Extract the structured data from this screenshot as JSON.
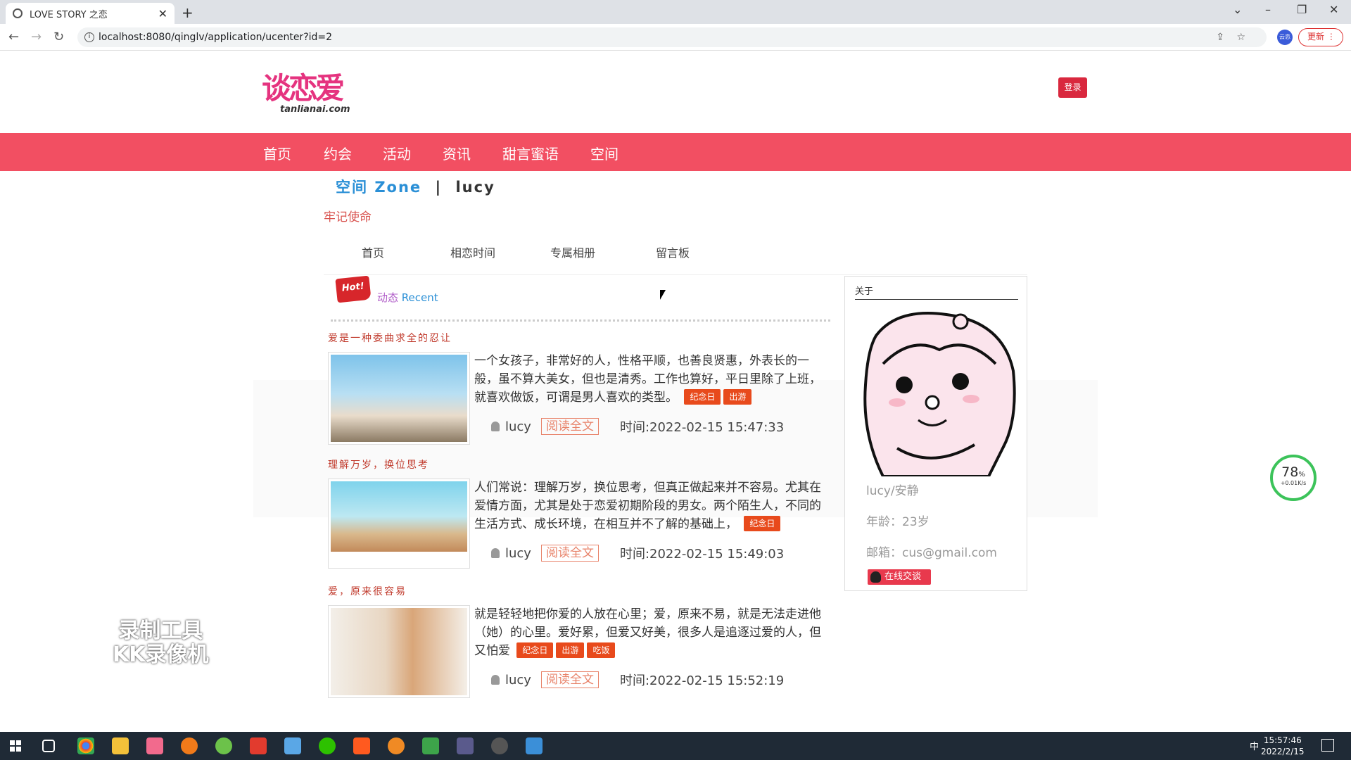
{
  "browser": {
    "tab_title": "LOVE STORY 之恋",
    "url": "localhost:8080/qinglv/application/ucenter?id=2",
    "update_label": "更新",
    "profile_chip": "云恋"
  },
  "site": {
    "logo_text": "谈恋爱",
    "logo_sub": "tanlianai.com",
    "login_label": "登录",
    "nav": [
      "首页",
      "约会",
      "活动",
      "资讯",
      "甜言蜜语",
      "空间"
    ]
  },
  "zone": {
    "title_cn": "空间",
    "title_en": "Zone",
    "separator": "|",
    "username": "lucy",
    "motto": "牢记使命",
    "subnav": [
      "首页",
      "相恋时间",
      "专属相册",
      "留言板"
    ]
  },
  "recent": {
    "hot_badge": "Hot!",
    "label_cn": "动态",
    "label_en": "Recent"
  },
  "posts": [
    {
      "title": "爱是一种委曲求全的忍让",
      "text": "一个女孩子，非常好的人，性格平顺，也善良贤惠，外表长的一般，虽不算大美女，但也是清秀。工作也算好，平日里除了上班，就喜欢做饭，可谓是男人喜欢的类型。",
      "tags": [
        "纪念日",
        "出游"
      ],
      "author": "lucy",
      "read_label": "阅读全文",
      "time": "时间:2022-02-15 15:47:33"
    },
    {
      "title": "理解万岁，换位思考",
      "text": "人们常说：理解万岁，换位思考，但真正做起来并不容易。尤其在爱情方面，尤其是处于恋爱初期阶段的男女。两个陌生人，不同的生活方式、成长环境，在相互并不了解的基础上，",
      "tags": [
        "纪念日"
      ],
      "author": "lucy",
      "read_label": "阅读全文",
      "time": "时间:2022-02-15 15:49:03"
    },
    {
      "title": "爱，原来很容易",
      "text": "就是轻轻地把你爱的人放在心里；爱，原来不易，就是无法走进他（她）的心里。爱好累，但爱又好美，很多人是追逐过爱的人，但又怕爱",
      "tags": [
        "纪念日",
        "出游",
        "吃饭"
      ],
      "author": "lucy",
      "read_label": "阅读全文",
      "time": "时间:2022-02-15 15:52:19"
    }
  ],
  "sidebar": {
    "heading": "关于",
    "name": "lucy/安静",
    "age": "年龄：23岁",
    "email": "邮箱：cus@gmail.com",
    "chat_label": "在线交谈"
  },
  "overlay": {
    "watermark_line1": "录制工具",
    "watermark_line2": "KK录像机",
    "speed_pct": "78",
    "speed_unit": "%",
    "speed_rate": "+0.01K/s"
  },
  "taskbar": {
    "time": "15:57:46",
    "date": "2022/2/15",
    "ime": "中"
  },
  "colors": {
    "nav_bg": "#f24f62",
    "accent_red": "#d9283e",
    "tag_orange": "#e84a1c",
    "zone_blue": "#2a8fd6"
  }
}
